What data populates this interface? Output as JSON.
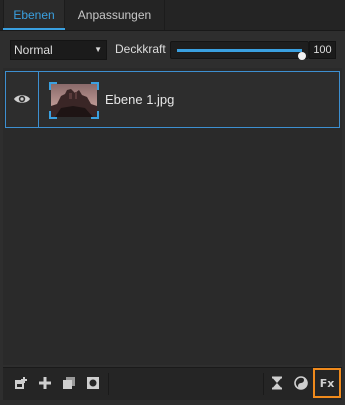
{
  "tabs": [
    {
      "label": "Ebenen",
      "active": true
    },
    {
      "label": "Anpassungen",
      "active": false
    }
  ],
  "blend_mode": {
    "selected": "Normal"
  },
  "opacity": {
    "label": "Deckkraft",
    "value": "100",
    "fraction": 1.0
  },
  "layers": [
    {
      "name": "Ebene 1.jpg",
      "visible": true,
      "selected": true
    }
  ],
  "toolbar": {
    "left_icons": [
      "new-layer-from-file-icon",
      "add-layer-icon",
      "duplicate-layer-icon",
      "layer-mask-icon"
    ],
    "right_icons": [
      "hourglass-icon",
      "blend-icon",
      "fx-icon"
    ],
    "fx_label": "Fx"
  },
  "colors": {
    "accent": "#3aa0e0",
    "highlight": "#f08a1c"
  }
}
